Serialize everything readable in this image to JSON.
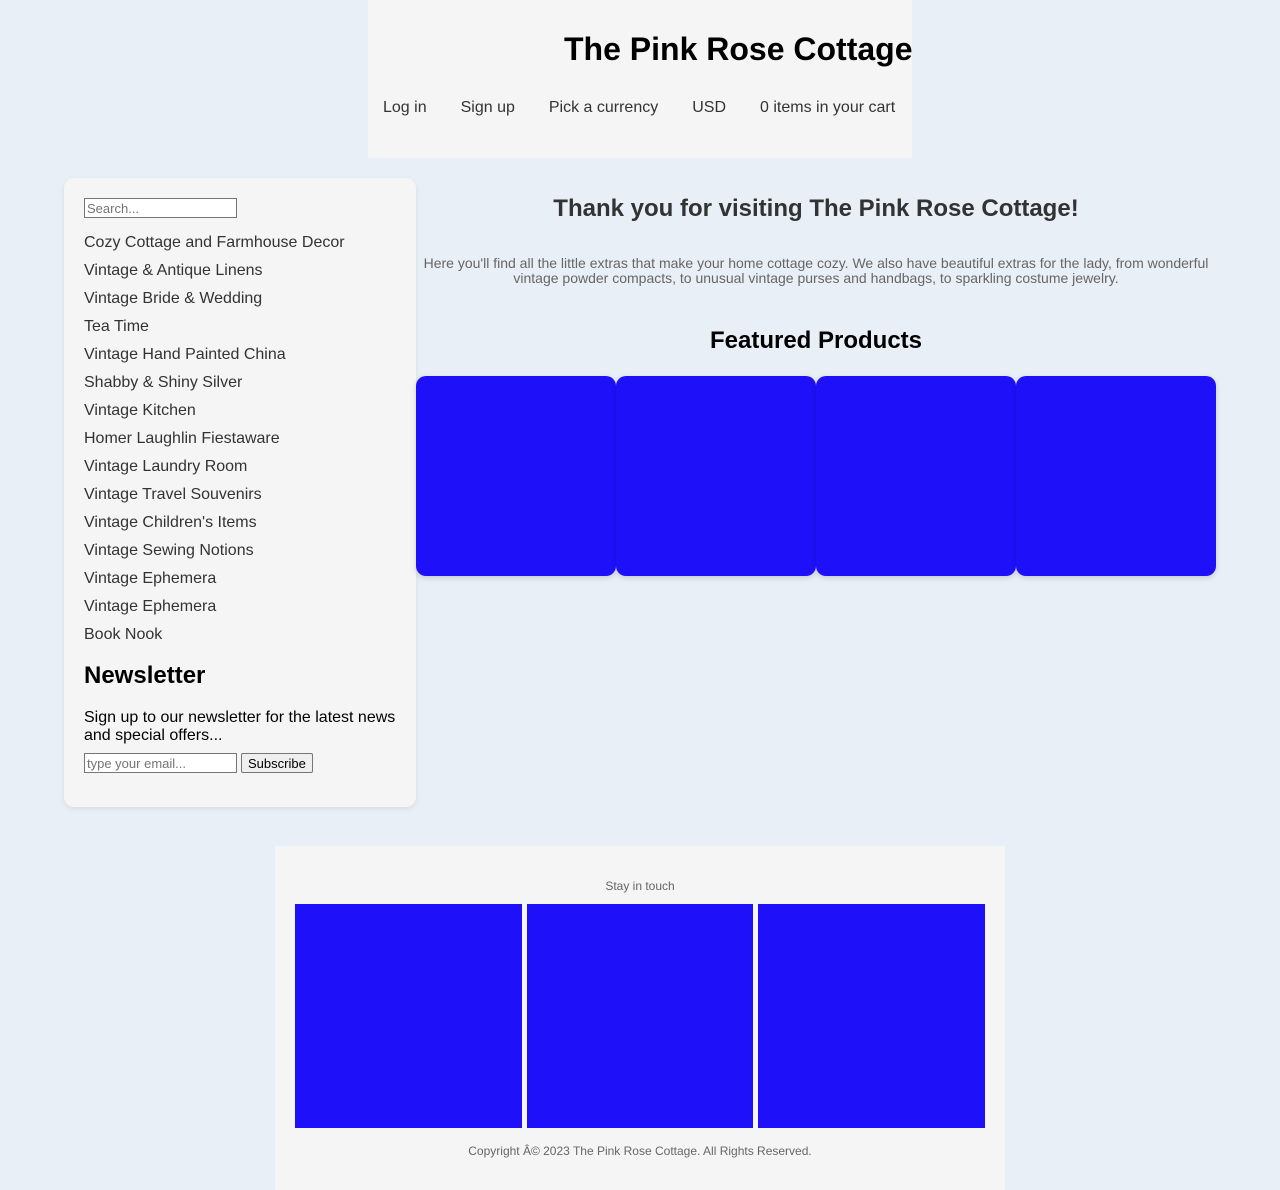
{
  "header": {
    "site_title": "The Pink Rose Cottage",
    "nav": {
      "login": "Log in",
      "signup": "Sign up",
      "pick_currency": "Pick a currency",
      "currency": "USD",
      "cart": "0 items in your cart"
    }
  },
  "sidebar": {
    "search_placeholder": "Search...",
    "categories": [
      "Cozy Cottage and Farmhouse Decor",
      "Vintage & Antique Linens",
      "Vintage Bride & Wedding",
      "Tea Time",
      "Vintage Hand Painted China",
      "Shabby & Shiny Silver",
      "Vintage Kitchen",
      "Homer Laughlin Fiestaware",
      "Vintage Laundry Room",
      "Vintage Travel Souvenirs",
      "Vintage Children's Items",
      "Vintage Sewing Notions",
      "Vintage Ephemera",
      "Vintage Ephemera",
      "Book Nook"
    ],
    "newsletter": {
      "title": "Newsletter",
      "text": "Sign up to our newsletter for the latest news and special offers...",
      "email_placeholder": "type your email...",
      "subscribe_label": "Subscribe"
    }
  },
  "main": {
    "welcome_heading": "Thank you for visiting The Pink Rose Cottage!",
    "welcome_text": "Here you'll find all the little extras that make your home cottage cozy. We also have beautiful extras for the lady, from wonderful vintage powder compacts, to unusual vintage purses and handbags, to sparkling costume jewelry.",
    "featured_heading": "Featured Products"
  },
  "footer": {
    "stay_in_touch": "Stay in touch",
    "copyright": "Copyright Â© 2023 The Pink Rose Cottage. All Rights Reserved."
  },
  "colors": {
    "page_background": "#e8eff7",
    "panel_background": "#f5f5f5",
    "image_placeholder": "#1e10f9"
  }
}
